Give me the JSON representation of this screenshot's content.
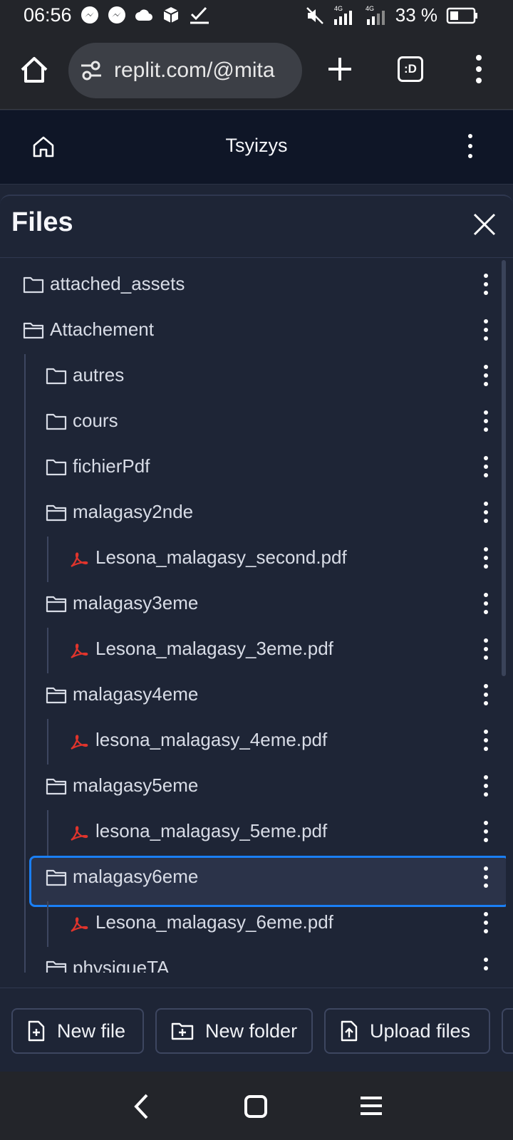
{
  "status_bar": {
    "time": "06:56",
    "battery_percent": "33 %",
    "network_label_1": "4G",
    "network_label_2": "4G"
  },
  "browser": {
    "url": "replit.com/@mita",
    "tabs_label": ":D"
  },
  "replit_header": {
    "title": "Tsyizys"
  },
  "files_panel": {
    "title": "Files",
    "items": [
      {
        "name": "attached_assets",
        "type": "folder",
        "open": false,
        "depth": 0
      },
      {
        "name": "Attachement",
        "type": "folder",
        "open": true,
        "depth": 0
      },
      {
        "name": "autres",
        "type": "folder",
        "open": false,
        "depth": 1
      },
      {
        "name": "cours",
        "type": "folder",
        "open": false,
        "depth": 1
      },
      {
        "name": "fichierPdf",
        "type": "folder",
        "open": false,
        "depth": 1
      },
      {
        "name": "malagasy2nde",
        "type": "folder",
        "open": true,
        "depth": 1
      },
      {
        "name": "Lesona_malagasy_second.pdf",
        "type": "pdf",
        "depth": 2
      },
      {
        "name": "malagasy3eme",
        "type": "folder",
        "open": true,
        "depth": 1
      },
      {
        "name": "Lesona_malagasy_3eme.pdf",
        "type": "pdf",
        "depth": 2
      },
      {
        "name": "malagasy4eme",
        "type": "folder",
        "open": true,
        "depth": 1
      },
      {
        "name": "lesona_malagasy_4eme.pdf",
        "type": "pdf",
        "depth": 2
      },
      {
        "name": "malagasy5eme",
        "type": "folder",
        "open": true,
        "depth": 1
      },
      {
        "name": "lesona_malagasy_5eme.pdf",
        "type": "pdf",
        "depth": 2
      },
      {
        "name": "malagasy6eme",
        "type": "folder",
        "open": true,
        "depth": 1,
        "selected": true
      },
      {
        "name": "Lesona_malagasy_6eme.pdf",
        "type": "pdf",
        "depth": 2
      },
      {
        "name": "physiqueTA",
        "type": "folder",
        "open": true,
        "depth": 1
      }
    ]
  },
  "actions": {
    "new_file": "New file",
    "new_folder": "New folder",
    "upload_files": "Upload files"
  },
  "colors": {
    "accent": "#1a7ff5",
    "pdf_icon": "#e0342c",
    "panel_bg": "#1e2536"
  }
}
